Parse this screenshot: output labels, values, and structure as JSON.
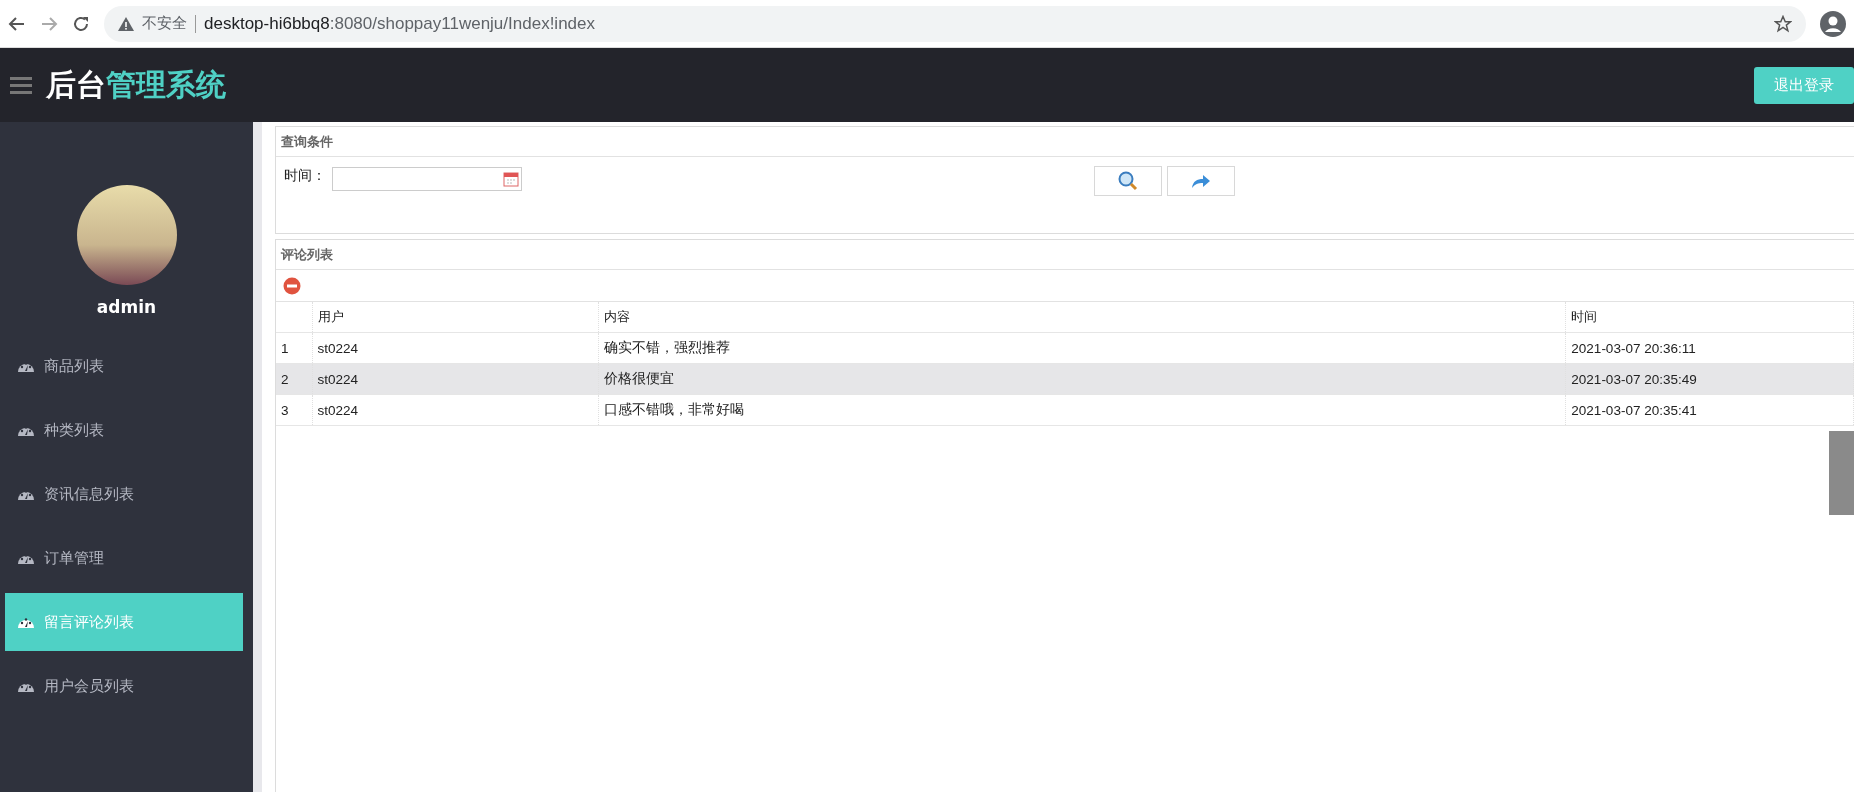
{
  "browser": {
    "security_label": "不安全",
    "url_host": "desktop-hi6bbq8",
    "url_rest": ":8080/shoppay11wenju/Index!index"
  },
  "header": {
    "title_lead": "后台",
    "title_accent": "管理系统",
    "logout_button": "退出登录"
  },
  "sidebar": {
    "username": "admin",
    "items": [
      {
        "label": "商品列表",
        "selected": false
      },
      {
        "label": "种类列表",
        "selected": false
      },
      {
        "label": "资讯信息列表",
        "selected": false
      },
      {
        "label": "订单管理",
        "selected": false
      },
      {
        "label": "留言评论列表",
        "selected": true
      },
      {
        "label": "用户会员列表",
        "selected": false
      }
    ]
  },
  "query_panel": {
    "title": "查询条件",
    "time_label": "时间："
  },
  "comment_panel": {
    "title": "评论列表",
    "table": {
      "columns": [
        "用户",
        "内容",
        "时间"
      ],
      "rows": [
        {
          "number": "1",
          "cells": [
            "st0224",
            "确实不错，强烈推荐",
            "2021-03-07 20:36:11"
          ],
          "selected": false
        },
        {
          "number": "2",
          "cells": [
            "st0224",
            "价格很便宜",
            "2021-03-07 20:35:49"
          ],
          "selected": true
        },
        {
          "number": "3",
          "cells": [
            "st0224",
            "口感不错哦，非常好喝",
            "2021-03-07 20:35:41"
          ],
          "selected": false
        }
      ]
    }
  }
}
